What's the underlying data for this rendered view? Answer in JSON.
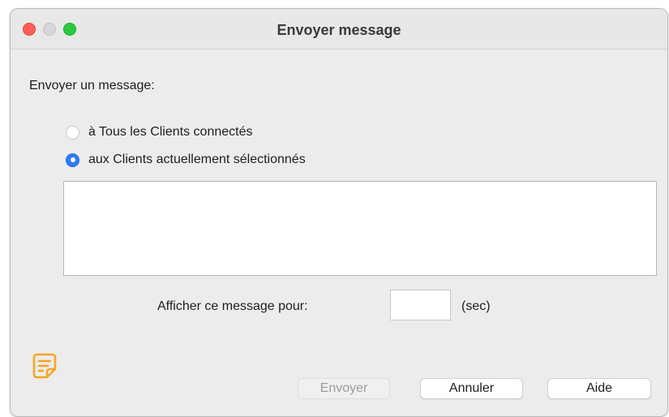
{
  "window": {
    "title": "Envoyer message"
  },
  "form": {
    "heading": "Envoyer un message:",
    "options": [
      {
        "label": "à Tous les Clients connectés",
        "selected": false
      },
      {
        "label": "aux Clients actuellement sélectionnés",
        "selected": true
      }
    ],
    "message_value": "",
    "duration_label": "Afficher ce message pour:",
    "duration_value": "",
    "duration_unit": "(sec)"
  },
  "buttons": {
    "send": "Envoyer",
    "cancel": "Annuler",
    "help": "Aide"
  },
  "icons": {
    "note": "note-icon"
  },
  "colors": {
    "accent": "#2e7cf6",
    "note_icon": "#f5a623"
  }
}
